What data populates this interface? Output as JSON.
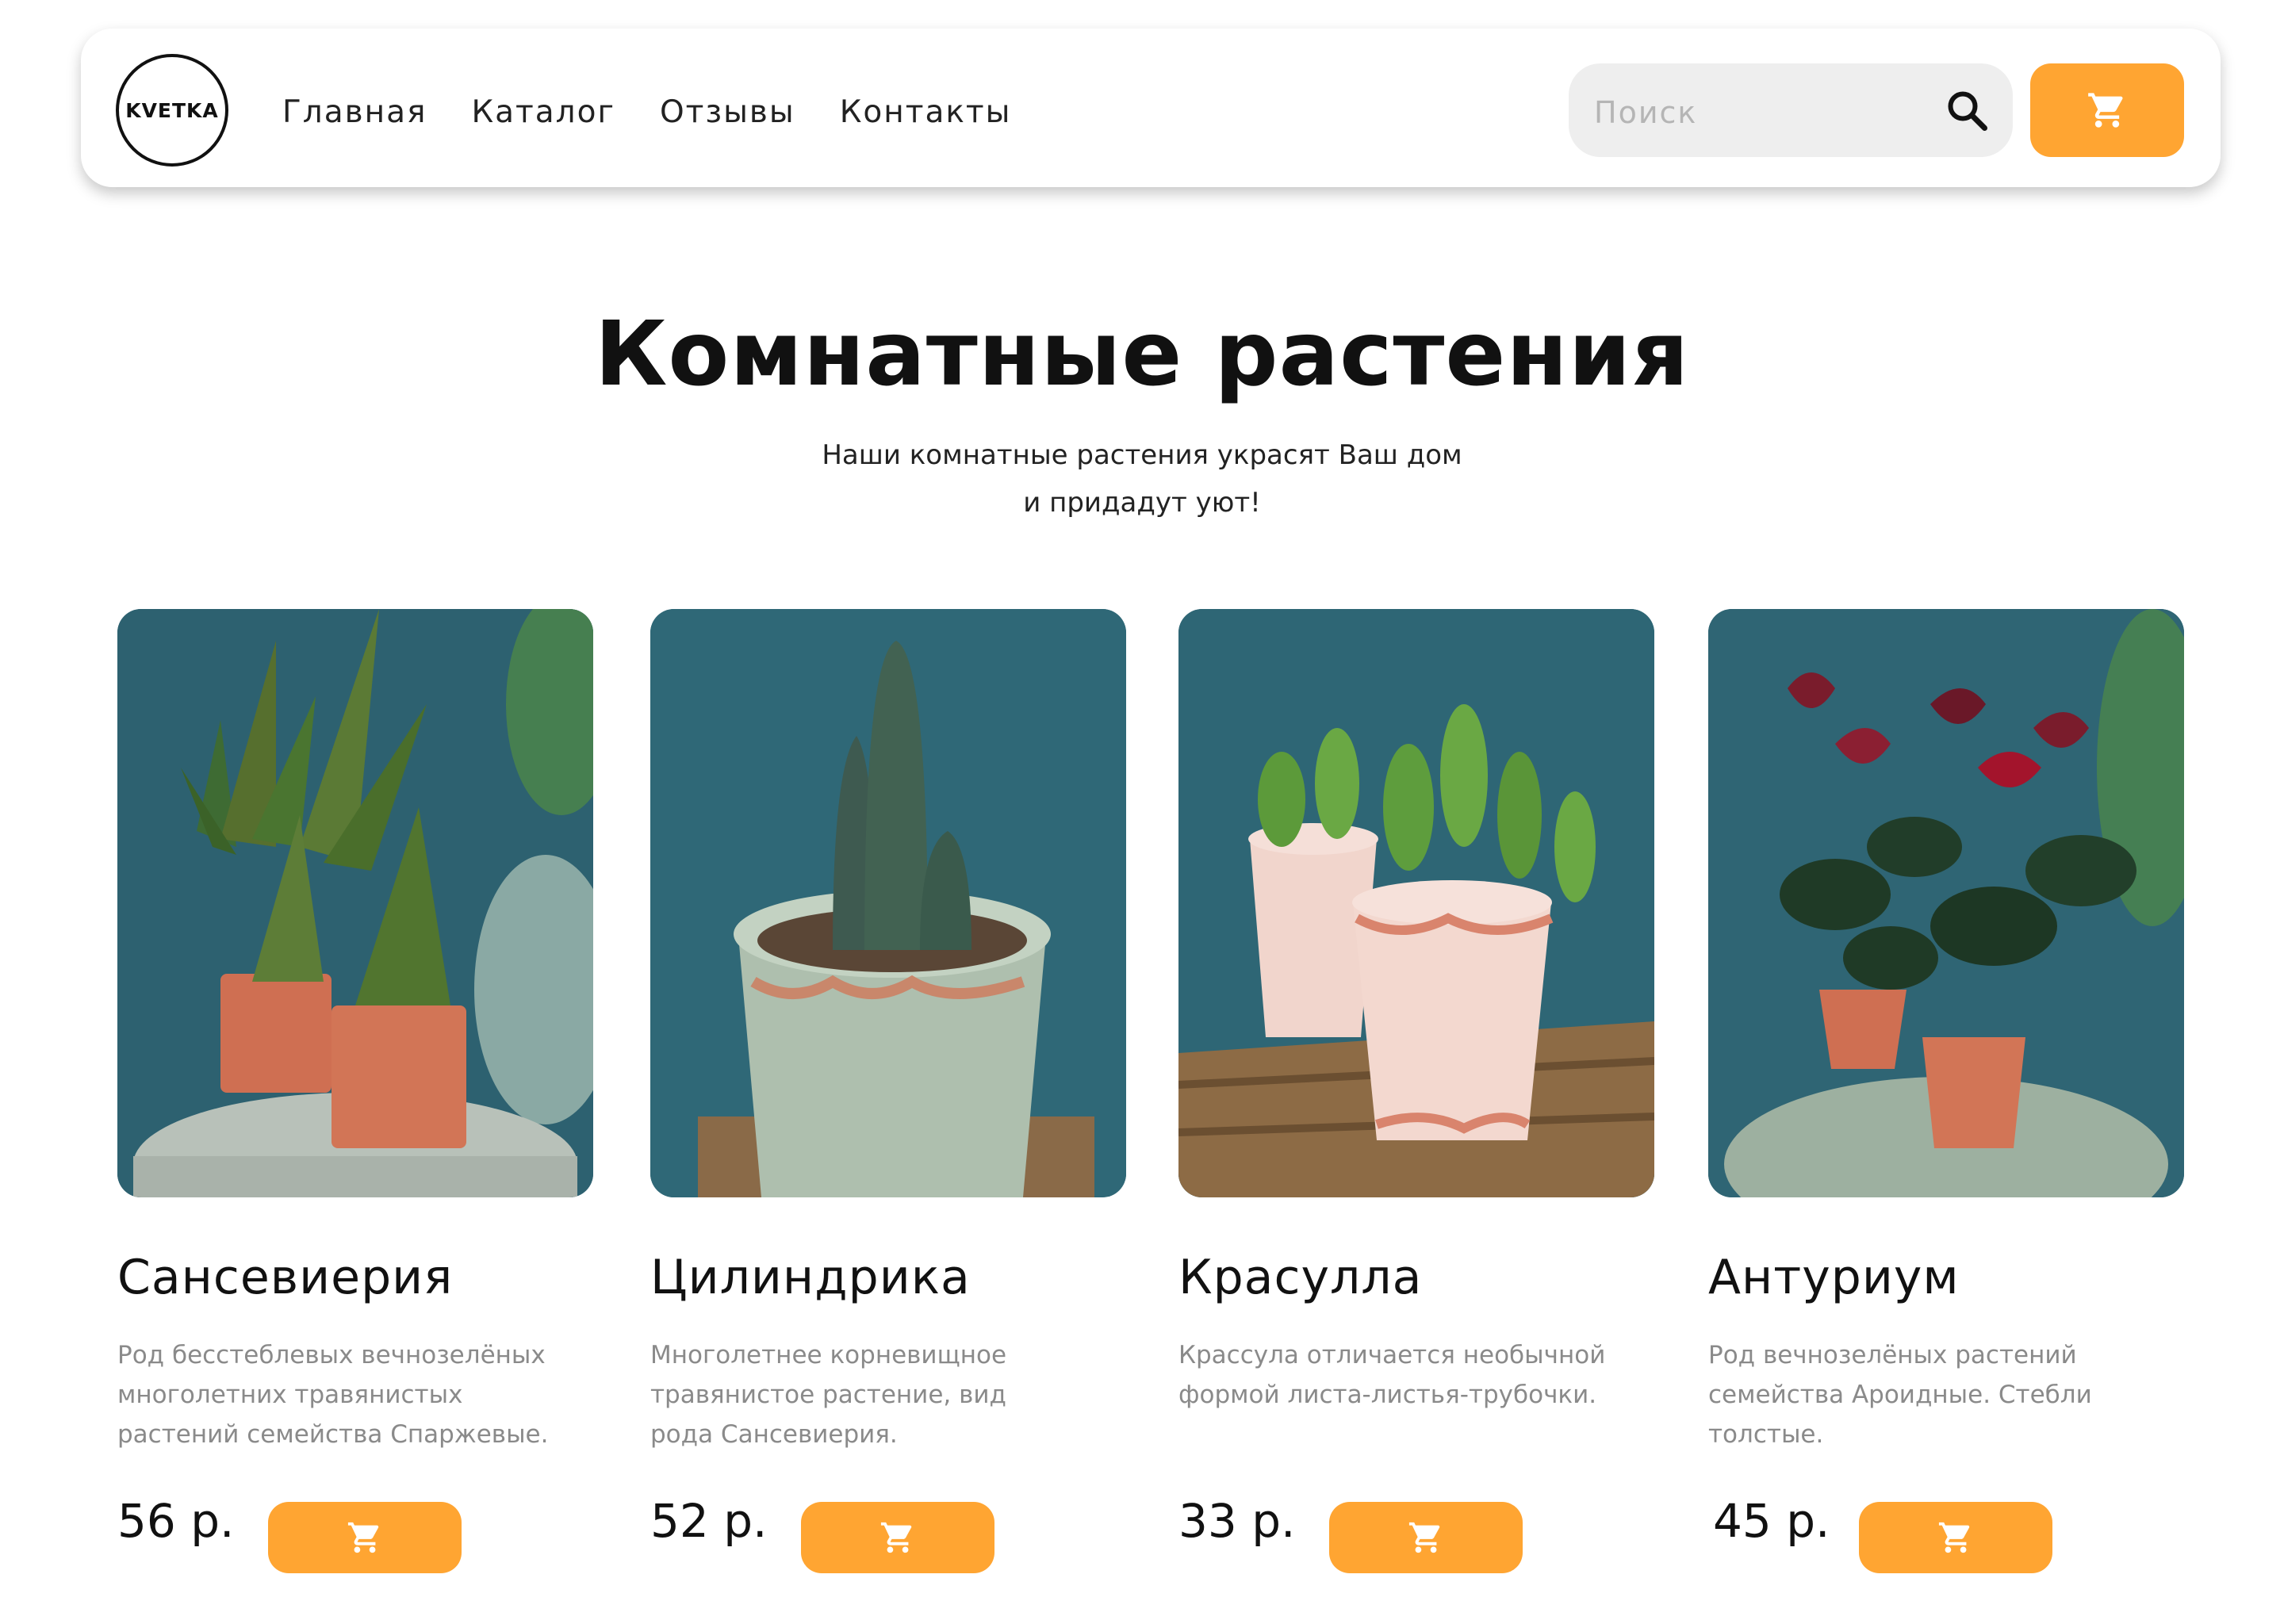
{
  "header": {
    "logo_text": "KVETKA",
    "nav": [
      {
        "label": "Главная"
      },
      {
        "label": "Каталог"
      },
      {
        "label": "Отзывы"
      },
      {
        "label": "Контакты"
      }
    ],
    "search_placeholder": "Поиск",
    "search_icon": "search-icon",
    "cart_icon": "cart-icon"
  },
  "hero": {
    "title": "Комнатные растения",
    "subtitle_line1": "Наши комнатные растения украсят Ваш дом",
    "subtitle_line2": "и придадут уют!"
  },
  "products": [
    {
      "name": "Сансевиерия",
      "desc_lines": [
        "Род бесстеблевых вечнозелёных",
        "многолетних травянистых",
        "растений семейства Спаржевые."
      ],
      "price": "56 р."
    },
    {
      "name": "Цилиндрика",
      "desc_lines": [
        "Многолетнее корневищное",
        "травянистое растение, вид",
        "рода Сансевиерия."
      ],
      "price": "52 р."
    },
    {
      "name": "Красулла",
      "desc_lines": [
        "Крассула  отличается необычной",
        "формой листа-листья-трубочки."
      ],
      "price": "33 р."
    },
    {
      "name": "Антуриум",
      "desc_lines": [
        "Род вечнозелёных растений",
        "семейства Ароидные. Стебли",
        "толстые."
      ],
      "price": "45 р."
    }
  ],
  "colors": {
    "accent": "#FFA532",
    "photo_background": "#2C6271",
    "description_text": "#8A8A8A",
    "search_background": "#EEEEEE"
  }
}
